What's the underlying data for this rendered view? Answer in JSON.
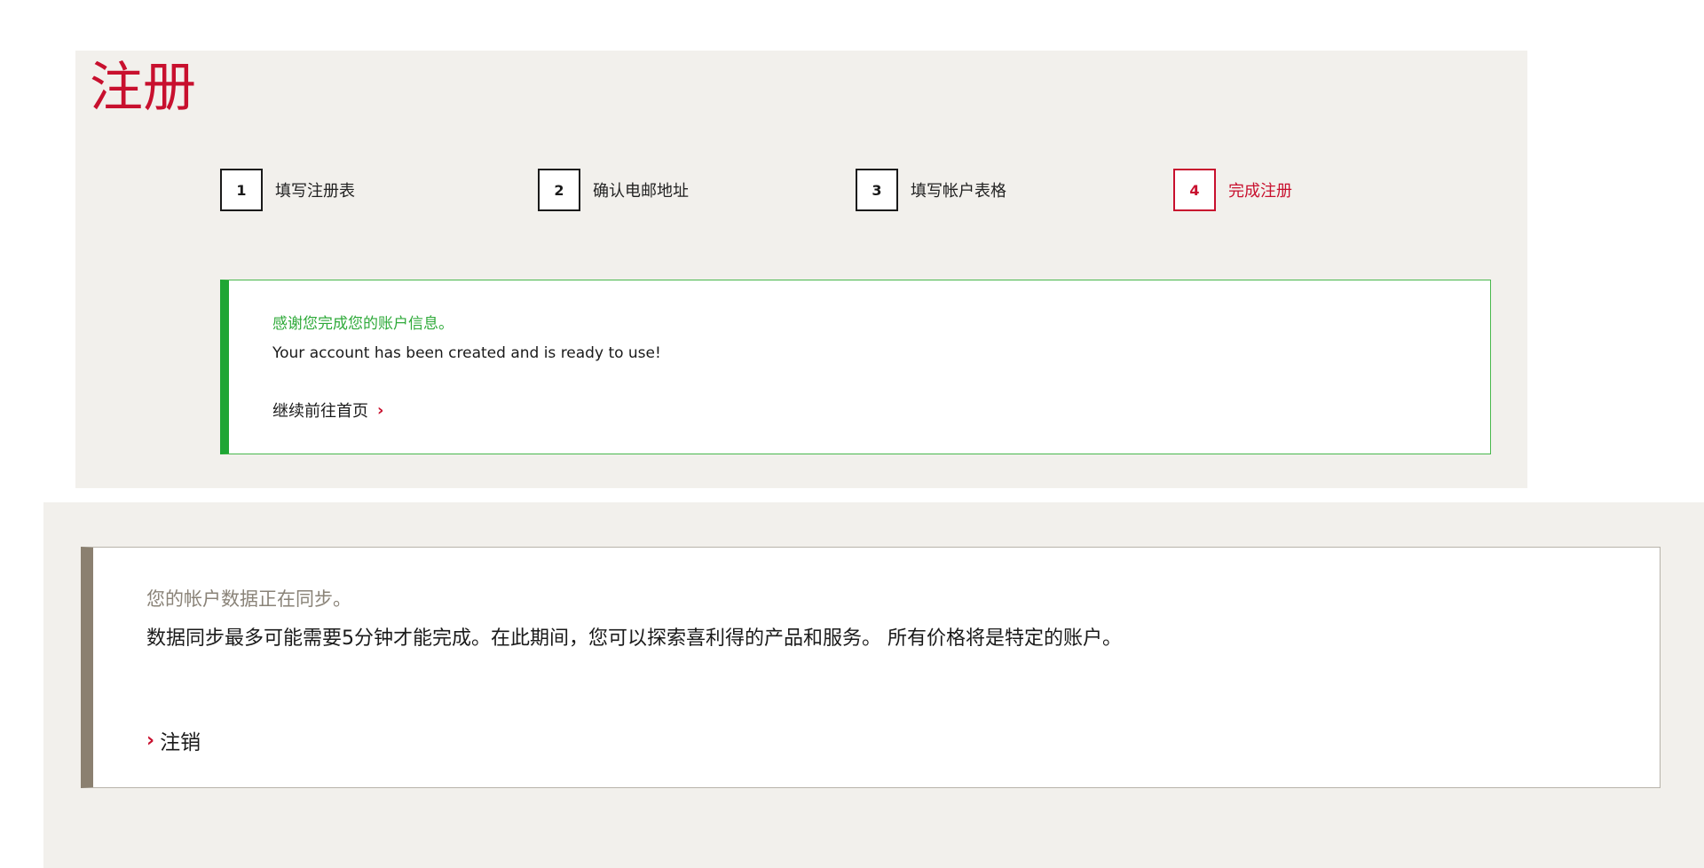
{
  "page": {
    "title": "注册"
  },
  "steps": [
    {
      "number": "1",
      "label": "填写注册表"
    },
    {
      "number": "2",
      "label": "确认电邮地址"
    },
    {
      "number": "3",
      "label": "填写帐户表格"
    },
    {
      "number": "4",
      "label": "完成注册"
    }
  ],
  "success": {
    "title": "感谢您完成您的账户信息。",
    "message": "Your account has been created and is ready to use!",
    "link_label": "继续前往首页",
    "link_icon": "chevron-right-icon"
  },
  "sync": {
    "title": "您的帐户数据正在同步。",
    "message": "数据同步最多可能需要5分钟才能完成。在此期间，您可以探索喜利得的产品和服务。 所有价格将是特定的账户。",
    "logout_label": "注销",
    "logout_icon": "chevron-right-icon"
  },
  "colors": {
    "brand_red": "#c8102e",
    "success_green": "#1fa634",
    "panel_bg": "#f2f0ec",
    "sync_accent": "#8b8070"
  }
}
